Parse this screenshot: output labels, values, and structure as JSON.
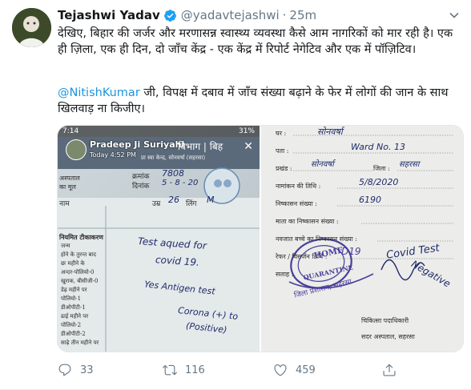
{
  "tweet": {
    "author_name": "Tejashwi Yadav",
    "handle": "@yadavtejashwi",
    "separator": "·",
    "time": "25m",
    "text_paragraph_1": "देखिए, बिहार की जर्जर और मरणासन्न स्वास्थ्य व्यवस्था कैसे आम नागरिकों को मार रही है। एक ही ज़िला, एक ही दिन, दो जाँच केंद्र - एक केंद्र में रिपोर्ट नेगेटिव और एक में पॉज़िटिव।",
    "mention": "@NitishKumar",
    "text_paragraph_2_rest": " जी, विपक्ष में दबाव में जाँच संख्या बढ़ाने के फेर में लोगों की जान के साथ खिलवाड़ ना किजीए।"
  },
  "media": {
    "left_image": {
      "status_time": "7:14",
      "status_battery": "31%",
      "story_name": "Pradeep Ji Suriyahi",
      "story_time": "Today 4:52 PM",
      "doc_header": "विभाग | बिह",
      "doc_sub": "प्रा स्वा केन्द्र, सोनवर्षा (सहरसा)",
      "doc_kramank": "क्रमांक",
      "doc_kramank_val": "7808",
      "doc_dinank": "दिनांक",
      "doc_dinank_val": "5 - 8 - 20",
      "doc_age_label": "उम्र",
      "doc_age_val": "26",
      "doc_sex_label": "लिंग",
      "doc_sex_val": "M",
      "doc_side_1": "अस्पताल",
      "doc_side_2": "का मूल",
      "doc_name_label": "नाम",
      "doc_vaccine_title": "नियमित टीकाकरण",
      "doc_vaccine_lines": [
        "जन्म",
        "होने के तुरन्त बाद",
        "छः महीने के",
        "अन्दर-पोलियो-0",
        "खुराक, बीसीजी-0",
        "डेढ़ महीने पर",
        "पोलियो-1",
        "डीओपीटी-1",
        "ढाई महीने पर",
        "पोलियो-2",
        "डीओपीटी-2",
        "साढ़े तीन महीने पर"
      ],
      "hand_1": "Test aqued for",
      "hand_2": "covid 19.",
      "hand_3": "Yes Antigen test",
      "hand_4": "Corona (+) to",
      "hand_5": "(Positive)"
    },
    "right_image": {
      "field_ghar": "घर :",
      "field_pata": "पता :",
      "field_prakhand": "प्रखंड :",
      "field_jila": "जिला :",
      "field_namankan": "नामांकन की तिथि :",
      "field_nishkasan": "निष्कासन संख्या :",
      "field_mata": "माता का निष्कासन संख्या :",
      "field_navjat": "नवजात बच्चे का निष्कासन संख्या :",
      "field_refer": "रेफर / विसर्जन तिथि :",
      "field_salah": "सलाह :",
      "footer_1": "चिकित्सा पदाधिकारी",
      "footer_2": "सदर अस्पताल, सहरसा",
      "hand_ghar": "सोनवर्षा",
      "hand_ward": "Ward No. 13",
      "hand_sonvarsha": "सोनवर्षा",
      "hand_saharsa": "सहरसा",
      "hand_date": "5/8/2020",
      "hand_num": "6190",
      "hand_covid": "Covid Test",
      "hand_negative": "Negative",
      "hand_d19": "D19",
      "stamp_top": "HOME",
      "stamp_bottom": "QUARANTINE",
      "stamp_hindi": "जिला प्रशासन, सहरसा"
    }
  },
  "actions": {
    "reply_count": "33",
    "retweet_count": "116",
    "like_count": "459"
  },
  "colors": {
    "link": "#1b95e0",
    "verified": "#1da1f2",
    "muted": "#657786"
  }
}
